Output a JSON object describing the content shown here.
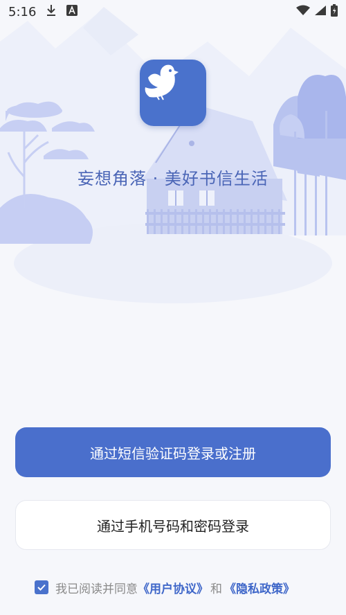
{
  "status_bar": {
    "time": "5:16"
  },
  "hero": {
    "slogan": "妄想角落 · 美好书信生活"
  },
  "buttons": {
    "sms_login": "通过短信验证码登录或注册",
    "password_login": "通过手机号码和密码登录"
  },
  "agreement": {
    "checked": true,
    "prefix": "我已阅读并同意",
    "user_agreement": "《用户协议》",
    "and": "和",
    "privacy_policy": "《隐私政策》"
  },
  "colors": {
    "primary": "#4a6fcc",
    "illustration": "#c5cdf0",
    "background": "#f6f7fb"
  }
}
